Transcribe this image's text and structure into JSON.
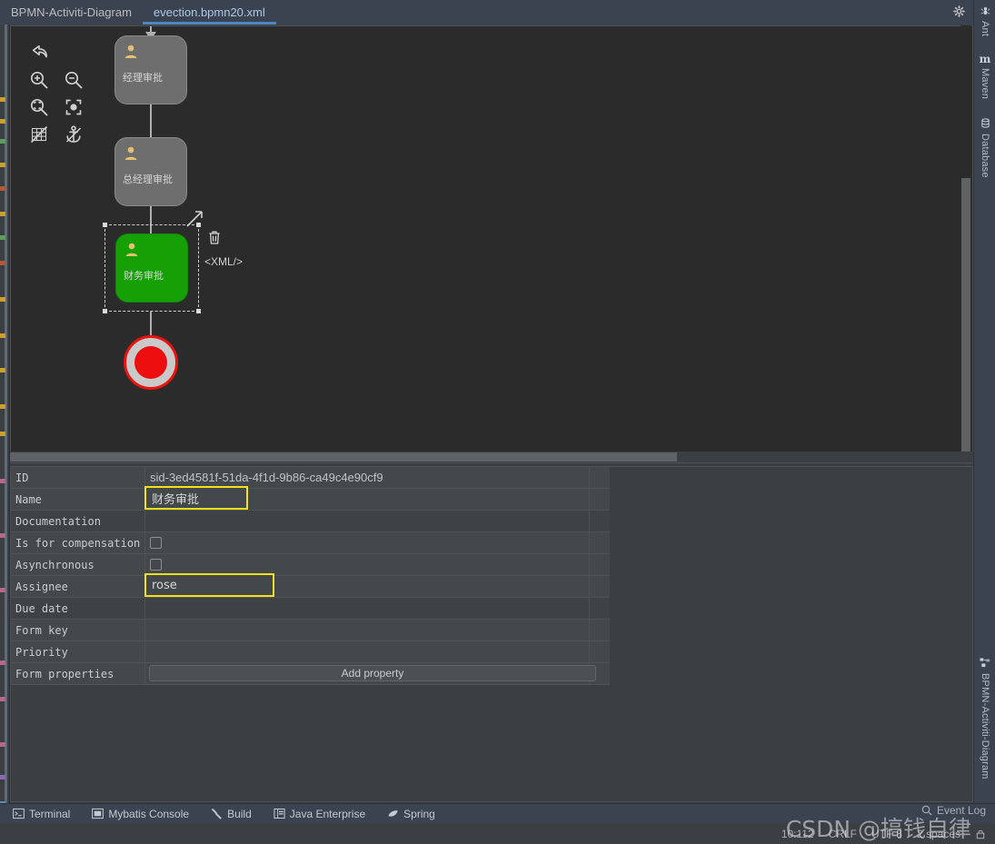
{
  "window": {
    "tabs": [
      {
        "label": "BPMN-Activiti-Diagram",
        "active": false
      },
      {
        "label": "evection.bpmn20.xml",
        "active": true
      }
    ],
    "controls": [
      {
        "name": "settings-gear",
        "glyph": "⚙"
      },
      {
        "name": "minimize",
        "glyph": "—"
      }
    ]
  },
  "canvas": {
    "tools": [
      {
        "name": "undo-icon",
        "title": "Undo"
      },
      {
        "name": "zoom-in-icon",
        "title": "Zoom In"
      },
      {
        "name": "zoom-out-icon",
        "title": "Zoom Out"
      },
      {
        "name": "zoom-actual-icon",
        "title": "Zoom Actual Size"
      },
      {
        "name": "zoom-fit-icon",
        "title": "Fit To Window"
      },
      {
        "name": "toggle-grid-icon",
        "title": "Toggle Grid"
      },
      {
        "name": "toggle-anchor-icon",
        "title": "Toggle Snap To Anchor"
      }
    ],
    "nodes": [
      {
        "label": "经理审批",
        "type": "user-task",
        "selected": false,
        "color": "#6e6e6e"
      },
      {
        "label": "总经理审批",
        "type": "user-task",
        "selected": false,
        "color": "#6e6e6e"
      },
      {
        "label": "财务审批",
        "type": "user-task",
        "selected": true,
        "color": "#16a006"
      }
    ],
    "end_event": {
      "name": "end-event",
      "ring_color": "#e8140d",
      "fill_color": "#ed0f0f"
    },
    "selection_actions": [
      {
        "name": "delete-icon",
        "label": "🗑"
      },
      {
        "name": "xml-badge",
        "label": "<XML/>"
      }
    ]
  },
  "properties": {
    "rows": [
      {
        "label": "ID",
        "value": "sid-3ed4581f-51da-4f1d-9b86-ca49c4e90cf9",
        "kind": "text",
        "highlight": false
      },
      {
        "label": "Name",
        "value": "财务审批",
        "kind": "text",
        "highlight": true
      },
      {
        "label": "Documentation",
        "value": "",
        "kind": "text",
        "highlight": false
      },
      {
        "label": "Is for compensation",
        "value": "",
        "kind": "checkbox",
        "checked": false,
        "highlight": false
      },
      {
        "label": "Asynchronous",
        "value": "",
        "kind": "checkbox",
        "checked": false,
        "highlight": false
      },
      {
        "label": "Assignee",
        "value": "rose",
        "kind": "text",
        "highlight": true
      },
      {
        "label": "Due date",
        "value": "",
        "kind": "text",
        "highlight": false
      },
      {
        "label": "Form key",
        "value": "",
        "kind": "text",
        "highlight": false
      },
      {
        "label": "Priority",
        "value": "",
        "kind": "text",
        "highlight": false
      },
      {
        "label": "Form properties",
        "value": "",
        "kind": "button",
        "button_label": "Add property",
        "highlight": false
      }
    ],
    "highlight_color": "#f2e11c"
  },
  "right_toolwindows": {
    "top": [
      {
        "label": "Ant",
        "icon": "ant-icon"
      },
      {
        "label": "Maven",
        "icon": "maven-icon"
      },
      {
        "label": "Database",
        "icon": "database-icon"
      }
    ],
    "bottom": [
      {
        "label": "BPMN-Activiti-Diagram",
        "icon": "bpmn-diagram-icon"
      }
    ]
  },
  "bottom_toolbar": {
    "items": [
      {
        "label": "Terminal",
        "icon": "terminal-icon"
      },
      {
        "label": "Mybatis Console",
        "icon": "mybatis-console-icon"
      },
      {
        "label": "Build",
        "icon": "build-hammer-icon"
      },
      {
        "label": "Java Enterprise",
        "icon": "java-enterprise-icon"
      },
      {
        "label": "Spring",
        "icon": "spring-leaf-icon"
      }
    ]
  },
  "status_bar": {
    "caret": "10:112",
    "line_separator": "CRLF",
    "encoding": "UTF-8",
    "indent": "2 spaces",
    "lock_icon": "lock-icon",
    "event_log": "Event Log"
  },
  "watermark": {
    "text": "CSDN @搞钱自律"
  }
}
